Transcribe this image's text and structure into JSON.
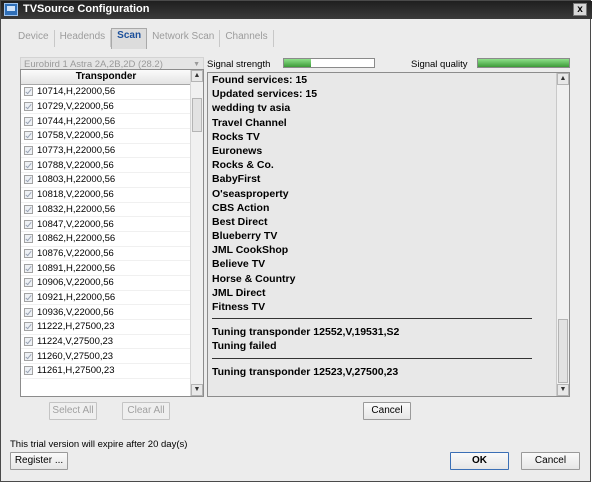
{
  "window": {
    "title": "TVSource Configuration",
    "close_symbol": "x"
  },
  "tabs": [
    {
      "label": "Device",
      "active": false
    },
    {
      "label": "Headends",
      "active": false
    },
    {
      "label": "Scan",
      "active": true
    },
    {
      "label": "Network Scan",
      "active": false
    },
    {
      "label": "Channels",
      "active": false
    }
  ],
  "satellite_select": {
    "value": "Eurobird 1   Astra 2A,2B,2D (28.2)"
  },
  "transponder_list": {
    "header": "Transponder",
    "items": [
      "10714,H,22000,56",
      "10729,V,22000,56",
      "10744,H,22000,56",
      "10758,V,22000,56",
      "10773,H,22000,56",
      "10788,V,22000,56",
      "10803,H,22000,56",
      "10818,V,22000,56",
      "10832,H,22000,56",
      "10847,V,22000,56",
      "10862,H,22000,56",
      "10876,V,22000,56",
      "10891,H,22000,56",
      "10906,V,22000,56",
      "10921,H,22000,56",
      "10936,V,22000,56",
      "11222,H,27500,23",
      "11224,V,27500,23",
      "11260,V,27500,23",
      "11261,H,27500,23"
    ]
  },
  "buttons": {
    "select_all": "Select All",
    "clear_all": "Clear All",
    "cancel_scan": "Cancel",
    "register": "Register ...",
    "ok": "OK",
    "cancel": "Cancel"
  },
  "signal": {
    "strength_label": "Signal strength",
    "quality_label": "Signal quality",
    "strength_level": 0.3,
    "quality_level": 1.0
  },
  "log": {
    "block1": [
      "Found services: 15",
      "Updated services: 15",
      "wedding tv asia",
      "Travel Channel",
      "Rocks TV",
      "Euronews",
      "Rocks & Co.",
      "BabyFirst",
      "O'seasproperty",
      "CBS Action",
      "Best Direct",
      "Blueberry TV",
      "JML CookShop",
      "Believe TV",
      "Horse & Country",
      "JML Direct",
      "Fitness TV"
    ],
    "block2": [
      "Tuning transponder 12552,V,19531,S2",
      "Tuning failed"
    ],
    "block3": [
      "Tuning transponder 12523,V,27500,23"
    ]
  },
  "footer": {
    "trial_text": "This trial version will expire after 20 day(s)"
  },
  "colors": {
    "signal_fill": "#3c9b38",
    "active_tab": "#1b4f9a"
  }
}
